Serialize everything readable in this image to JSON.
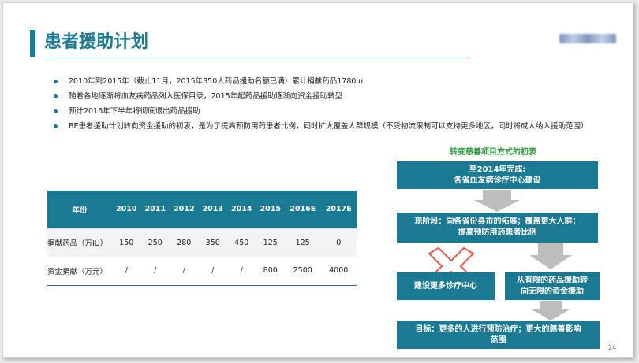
{
  "slide": {
    "title": "患者援助计划",
    "page_number": "24"
  },
  "bullets": [
    "2010年到2015年（截止11月，2015年350人药品援助名额已满）累计捐献药品1780iu",
    "随着各地逐渐将血友病药品列入医保目录，2015年起药品援助逐渐向资金援助转型",
    "预计2016年下半年将彻底退出药品援助",
    "BE患者援助计划转向资金援助的初衷，是为了提高预防用药患者比例，同时扩大覆盖人群规模（不受物流限制可以支持更多地区，同时将成人纳入援助范围）"
  ],
  "table": {
    "header": [
      "年份",
      "2010",
      "2011",
      "2012",
      "2013",
      "2014",
      "2015",
      "2016E",
      "2017E"
    ],
    "rows": [
      [
        "捐献药品（万IU）",
        "150",
        "250",
        "280",
        "350",
        "450",
        "125",
        "125",
        "0"
      ],
      [
        "资金捐献（万元）",
        "/",
        "/",
        "/",
        "/",
        "/",
        "800",
        "2500",
        "4000"
      ]
    ]
  },
  "flow": {
    "title": "转变慈善项目方式的初衷",
    "box1": [
      "至2014年完成:",
      "各省血友病诊疗中心建设"
    ],
    "box2": [
      "现阶段：向各省份县市的拓展；覆盖更大人群；",
      "提高预防用药患者比例"
    ],
    "box3": "建设更多诊疗中心",
    "box4": [
      "从有限的药品援助转",
      "向无限的资金援助"
    ],
    "box5": [
      "目标：更多的人进行预防治疗；更大的慈善影响",
      "范围"
    ]
  },
  "colors": {
    "accent": "#1a7a93",
    "flow_title": "#2e9e3e",
    "arrow": "#bdbdbd",
    "cross": "#e05a4e"
  },
  "icons": {
    "logo": "blurred-company-logo",
    "cross": "red-x-mark"
  }
}
